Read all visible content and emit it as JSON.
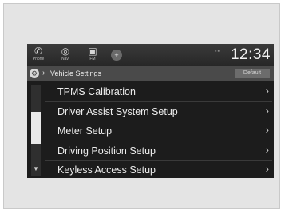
{
  "top_bar": {
    "phone_label": "Phone",
    "navi_label": "Navi",
    "fm_label": "FM",
    "plus_glyph": "+",
    "clock": "12:34"
  },
  "breadcrumb": {
    "title": "Vehicle Settings",
    "default_label": "Default"
  },
  "menu": {
    "items": [
      {
        "label": "TPMS Calibration"
      },
      {
        "label": "Driver Assist System Setup"
      },
      {
        "label": "Meter Setup"
      },
      {
        "label": "Driving Position Setup"
      },
      {
        "label": "Keyless Access Setup"
      }
    ]
  },
  "colors": {
    "screen_bg": "#1c1c1c",
    "header_bg": "#4a4a4a",
    "text": "#ececec"
  }
}
